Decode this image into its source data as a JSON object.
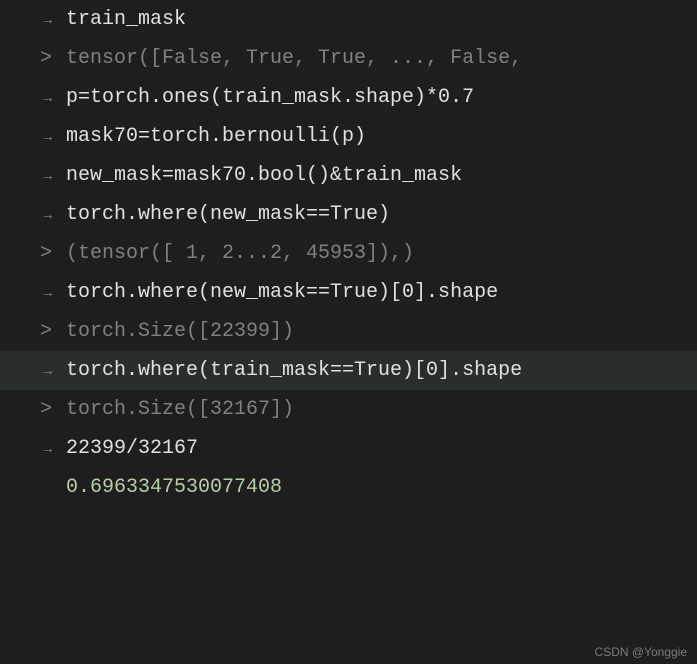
{
  "lines": [
    {
      "type": "input",
      "text": "train_mask"
    },
    {
      "type": "output",
      "text": "tensor([False,  True,  True,  ..., False,"
    },
    {
      "type": "input",
      "text": "p=torch.ones(train_mask.shape)*0.7"
    },
    {
      "type": "blank",
      "text": ""
    },
    {
      "type": "input",
      "text": "mask70=torch.bernoulli(p)"
    },
    {
      "type": "blank",
      "text": ""
    },
    {
      "type": "input",
      "text": "new_mask=mask70.bool()&train_mask"
    },
    {
      "type": "blank",
      "text": ""
    },
    {
      "type": "input",
      "text": "torch.where(new_mask==True)"
    },
    {
      "type": "output",
      "text": "(tensor([    1,     2...2, 45953]),)"
    },
    {
      "type": "input",
      "text": "torch.where(new_mask==True)[0].shape"
    },
    {
      "type": "output",
      "text": "torch.Size([22399])"
    },
    {
      "type": "input",
      "text": "torch.where(train_mask==True)[0].shape",
      "highlight": true
    },
    {
      "type": "output",
      "text": "torch.Size([32167])"
    },
    {
      "type": "input",
      "text": "22399/32167"
    },
    {
      "type": "result",
      "text": "0.6963347530077408"
    }
  ],
  "watermark": "CSDN @Yonggie"
}
